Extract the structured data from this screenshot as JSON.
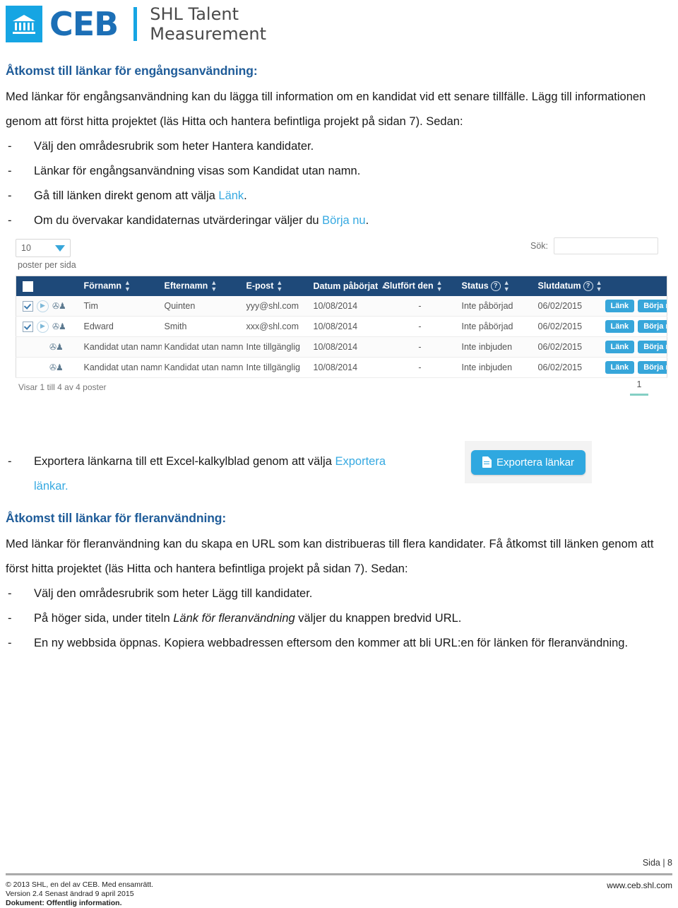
{
  "header": {
    "brand": "CEB",
    "sub_line1": "SHL Talent",
    "sub_line2": "Measurement",
    "mark_icon": "bank-building-icon",
    "brand_blue": "#1c6fb6",
    "accent_blue": "#16a5e3"
  },
  "section1": {
    "heading": "Åtkomst till länkar för engångsanvändning:",
    "intro_a": "Med länkar för engångsanvändning kan du lägga till information om en kandidat vid ett senare tillfälle. Lägg till informationen genom att först hitta projektet (läs Hitta och hantera befintliga projekt på sidan 7). Sedan:",
    "bullets": [
      {
        "text": "Välj den områdesrubrik som heter Hantera kandidater."
      },
      {
        "text": "Länkar för engångsanvändning visas som Kandidat utan namn."
      },
      {
        "pre": "Gå till länken direkt genom att välja ",
        "link": "Länk",
        "post": "."
      },
      {
        "pre": "Om du övervakar kandidaternas utvärderingar väljer du ",
        "link": "Börja nu",
        "post": "."
      }
    ]
  },
  "app": {
    "per_page_value": "10",
    "per_page_label": "poster per sida",
    "search_label": "Sök:",
    "search_value": "",
    "columns": [
      "",
      "Förnamn",
      "Efternamn",
      "E-post",
      "Datum påbörjat",
      "Slutfört den",
      "Status",
      "Slutdatum",
      ""
    ],
    "rows": [
      {
        "checked": true,
        "expandable": true,
        "first_name": "Tim",
        "last_name": "Quinten",
        "email": "yyy@shl.com",
        "date_started": "10/08/2014",
        "completed": "-",
        "status": "Inte påbörjad",
        "end_date": "06/02/2015",
        "btn_link": "Länk",
        "btn_start": "Börja nu"
      },
      {
        "checked": true,
        "expandable": true,
        "first_name": "Edward",
        "last_name": "Smith",
        "email": "xxx@shl.com",
        "date_started": "10/08/2014",
        "completed": "-",
        "status": "Inte påbörjad",
        "end_date": "06/02/2015",
        "btn_link": "Länk",
        "btn_start": "Börja nu"
      },
      {
        "checked": false,
        "expandable": false,
        "first_name": "Kandidat utan namn",
        "last_name": "Kandidat utan namn",
        "email": "Inte tillgänglig",
        "date_started": "10/08/2014",
        "completed": "-",
        "status": "Inte inbjuden",
        "end_date": "06/02/2015",
        "btn_link": "Länk",
        "btn_start": "Börja nu"
      },
      {
        "checked": false,
        "expandable": false,
        "first_name": "Kandidat utan namn",
        "last_name": "Kandidat utan namn",
        "email": "Inte tillgänglig",
        "date_started": "10/08/2014",
        "completed": "-",
        "status": "Inte inbjuden",
        "end_date": "06/02/2015",
        "btn_link": "Länk",
        "btn_start": "Börja nu"
      }
    ],
    "showing_text": "Visar 1 till 4 av 4 poster",
    "page_number": "1"
  },
  "export": {
    "bullet_pre": "Exportera länkarna till ett Excel-kalkylblad genom att välja ",
    "bullet_link_a": "Exportera",
    "bullet_link_b": "länkar.",
    "button_label": "Exportera länkar",
    "button_icon": "document-icon"
  },
  "section2": {
    "heading": "Åtkomst till länkar för fleranvändning:",
    "intro": "Med länkar för fleranvändning kan du skapa en URL som kan distribueras till flera kandidater. Få åtkomst till länken genom att först hitta projektet (läs Hitta och hantera befintliga projekt på sidan 7). Sedan:",
    "b1": "Välj den områdesrubrik som heter Lägg till kandidater.",
    "b2_pre": "På höger sida, under titeln ",
    "b2_ital": "Länk för fleranvändning",
    "b2_post": " väljer du knappen bredvid URL.",
    "b3": "En ny webbsida öppnas. Kopiera webbadressen eftersom den kommer att bli URL:en för länken för fleranvändning."
  },
  "footer": {
    "page_label": "Sida | 8",
    "copyright": "© 2013 SHL, en del av CEB. Med ensamrätt.",
    "version": "Version 2.4  Senast ändrad 9 april 2015",
    "document_prefix": "Dokument: ",
    "document_value": "Offentlig information.",
    "website": "www.ceb.shl.com"
  }
}
